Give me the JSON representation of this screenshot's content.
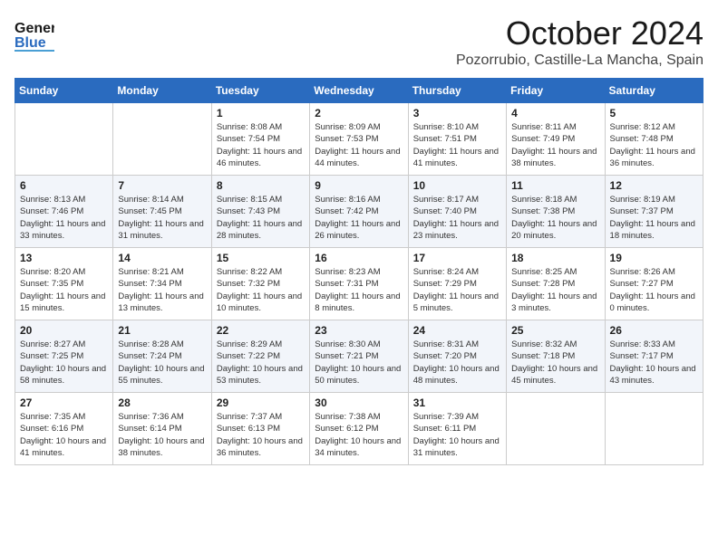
{
  "logo": {
    "line1": "General",
    "line2": "Blue"
  },
  "title": "October 2024",
  "location": "Pozorrubio, Castille-La Mancha, Spain",
  "days_of_week": [
    "Sunday",
    "Monday",
    "Tuesday",
    "Wednesday",
    "Thursday",
    "Friday",
    "Saturday"
  ],
  "weeks": [
    [
      {
        "day": "",
        "content": ""
      },
      {
        "day": "",
        "content": ""
      },
      {
        "day": "1",
        "content": "Sunrise: 8:08 AM\nSunset: 7:54 PM\nDaylight: 11 hours and 46 minutes."
      },
      {
        "day": "2",
        "content": "Sunrise: 8:09 AM\nSunset: 7:53 PM\nDaylight: 11 hours and 44 minutes."
      },
      {
        "day": "3",
        "content": "Sunrise: 8:10 AM\nSunset: 7:51 PM\nDaylight: 11 hours and 41 minutes."
      },
      {
        "day": "4",
        "content": "Sunrise: 8:11 AM\nSunset: 7:49 PM\nDaylight: 11 hours and 38 minutes."
      },
      {
        "day": "5",
        "content": "Sunrise: 8:12 AM\nSunset: 7:48 PM\nDaylight: 11 hours and 36 minutes."
      }
    ],
    [
      {
        "day": "6",
        "content": "Sunrise: 8:13 AM\nSunset: 7:46 PM\nDaylight: 11 hours and 33 minutes."
      },
      {
        "day": "7",
        "content": "Sunrise: 8:14 AM\nSunset: 7:45 PM\nDaylight: 11 hours and 31 minutes."
      },
      {
        "day": "8",
        "content": "Sunrise: 8:15 AM\nSunset: 7:43 PM\nDaylight: 11 hours and 28 minutes."
      },
      {
        "day": "9",
        "content": "Sunrise: 8:16 AM\nSunset: 7:42 PM\nDaylight: 11 hours and 26 minutes."
      },
      {
        "day": "10",
        "content": "Sunrise: 8:17 AM\nSunset: 7:40 PM\nDaylight: 11 hours and 23 minutes."
      },
      {
        "day": "11",
        "content": "Sunrise: 8:18 AM\nSunset: 7:38 PM\nDaylight: 11 hours and 20 minutes."
      },
      {
        "day": "12",
        "content": "Sunrise: 8:19 AM\nSunset: 7:37 PM\nDaylight: 11 hours and 18 minutes."
      }
    ],
    [
      {
        "day": "13",
        "content": "Sunrise: 8:20 AM\nSunset: 7:35 PM\nDaylight: 11 hours and 15 minutes."
      },
      {
        "day": "14",
        "content": "Sunrise: 8:21 AM\nSunset: 7:34 PM\nDaylight: 11 hours and 13 minutes."
      },
      {
        "day": "15",
        "content": "Sunrise: 8:22 AM\nSunset: 7:32 PM\nDaylight: 11 hours and 10 minutes."
      },
      {
        "day": "16",
        "content": "Sunrise: 8:23 AM\nSunset: 7:31 PM\nDaylight: 11 hours and 8 minutes."
      },
      {
        "day": "17",
        "content": "Sunrise: 8:24 AM\nSunset: 7:29 PM\nDaylight: 11 hours and 5 minutes."
      },
      {
        "day": "18",
        "content": "Sunrise: 8:25 AM\nSunset: 7:28 PM\nDaylight: 11 hours and 3 minutes."
      },
      {
        "day": "19",
        "content": "Sunrise: 8:26 AM\nSunset: 7:27 PM\nDaylight: 11 hours and 0 minutes."
      }
    ],
    [
      {
        "day": "20",
        "content": "Sunrise: 8:27 AM\nSunset: 7:25 PM\nDaylight: 10 hours and 58 minutes."
      },
      {
        "day": "21",
        "content": "Sunrise: 8:28 AM\nSunset: 7:24 PM\nDaylight: 10 hours and 55 minutes."
      },
      {
        "day": "22",
        "content": "Sunrise: 8:29 AM\nSunset: 7:22 PM\nDaylight: 10 hours and 53 minutes."
      },
      {
        "day": "23",
        "content": "Sunrise: 8:30 AM\nSunset: 7:21 PM\nDaylight: 10 hours and 50 minutes."
      },
      {
        "day": "24",
        "content": "Sunrise: 8:31 AM\nSunset: 7:20 PM\nDaylight: 10 hours and 48 minutes."
      },
      {
        "day": "25",
        "content": "Sunrise: 8:32 AM\nSunset: 7:18 PM\nDaylight: 10 hours and 45 minutes."
      },
      {
        "day": "26",
        "content": "Sunrise: 8:33 AM\nSunset: 7:17 PM\nDaylight: 10 hours and 43 minutes."
      }
    ],
    [
      {
        "day": "27",
        "content": "Sunrise: 7:35 AM\nSunset: 6:16 PM\nDaylight: 10 hours and 41 minutes."
      },
      {
        "day": "28",
        "content": "Sunrise: 7:36 AM\nSunset: 6:14 PM\nDaylight: 10 hours and 38 minutes."
      },
      {
        "day": "29",
        "content": "Sunrise: 7:37 AM\nSunset: 6:13 PM\nDaylight: 10 hours and 36 minutes."
      },
      {
        "day": "30",
        "content": "Sunrise: 7:38 AM\nSunset: 6:12 PM\nDaylight: 10 hours and 34 minutes."
      },
      {
        "day": "31",
        "content": "Sunrise: 7:39 AM\nSunset: 6:11 PM\nDaylight: 10 hours and 31 minutes."
      },
      {
        "day": "",
        "content": ""
      },
      {
        "day": "",
        "content": ""
      }
    ]
  ]
}
